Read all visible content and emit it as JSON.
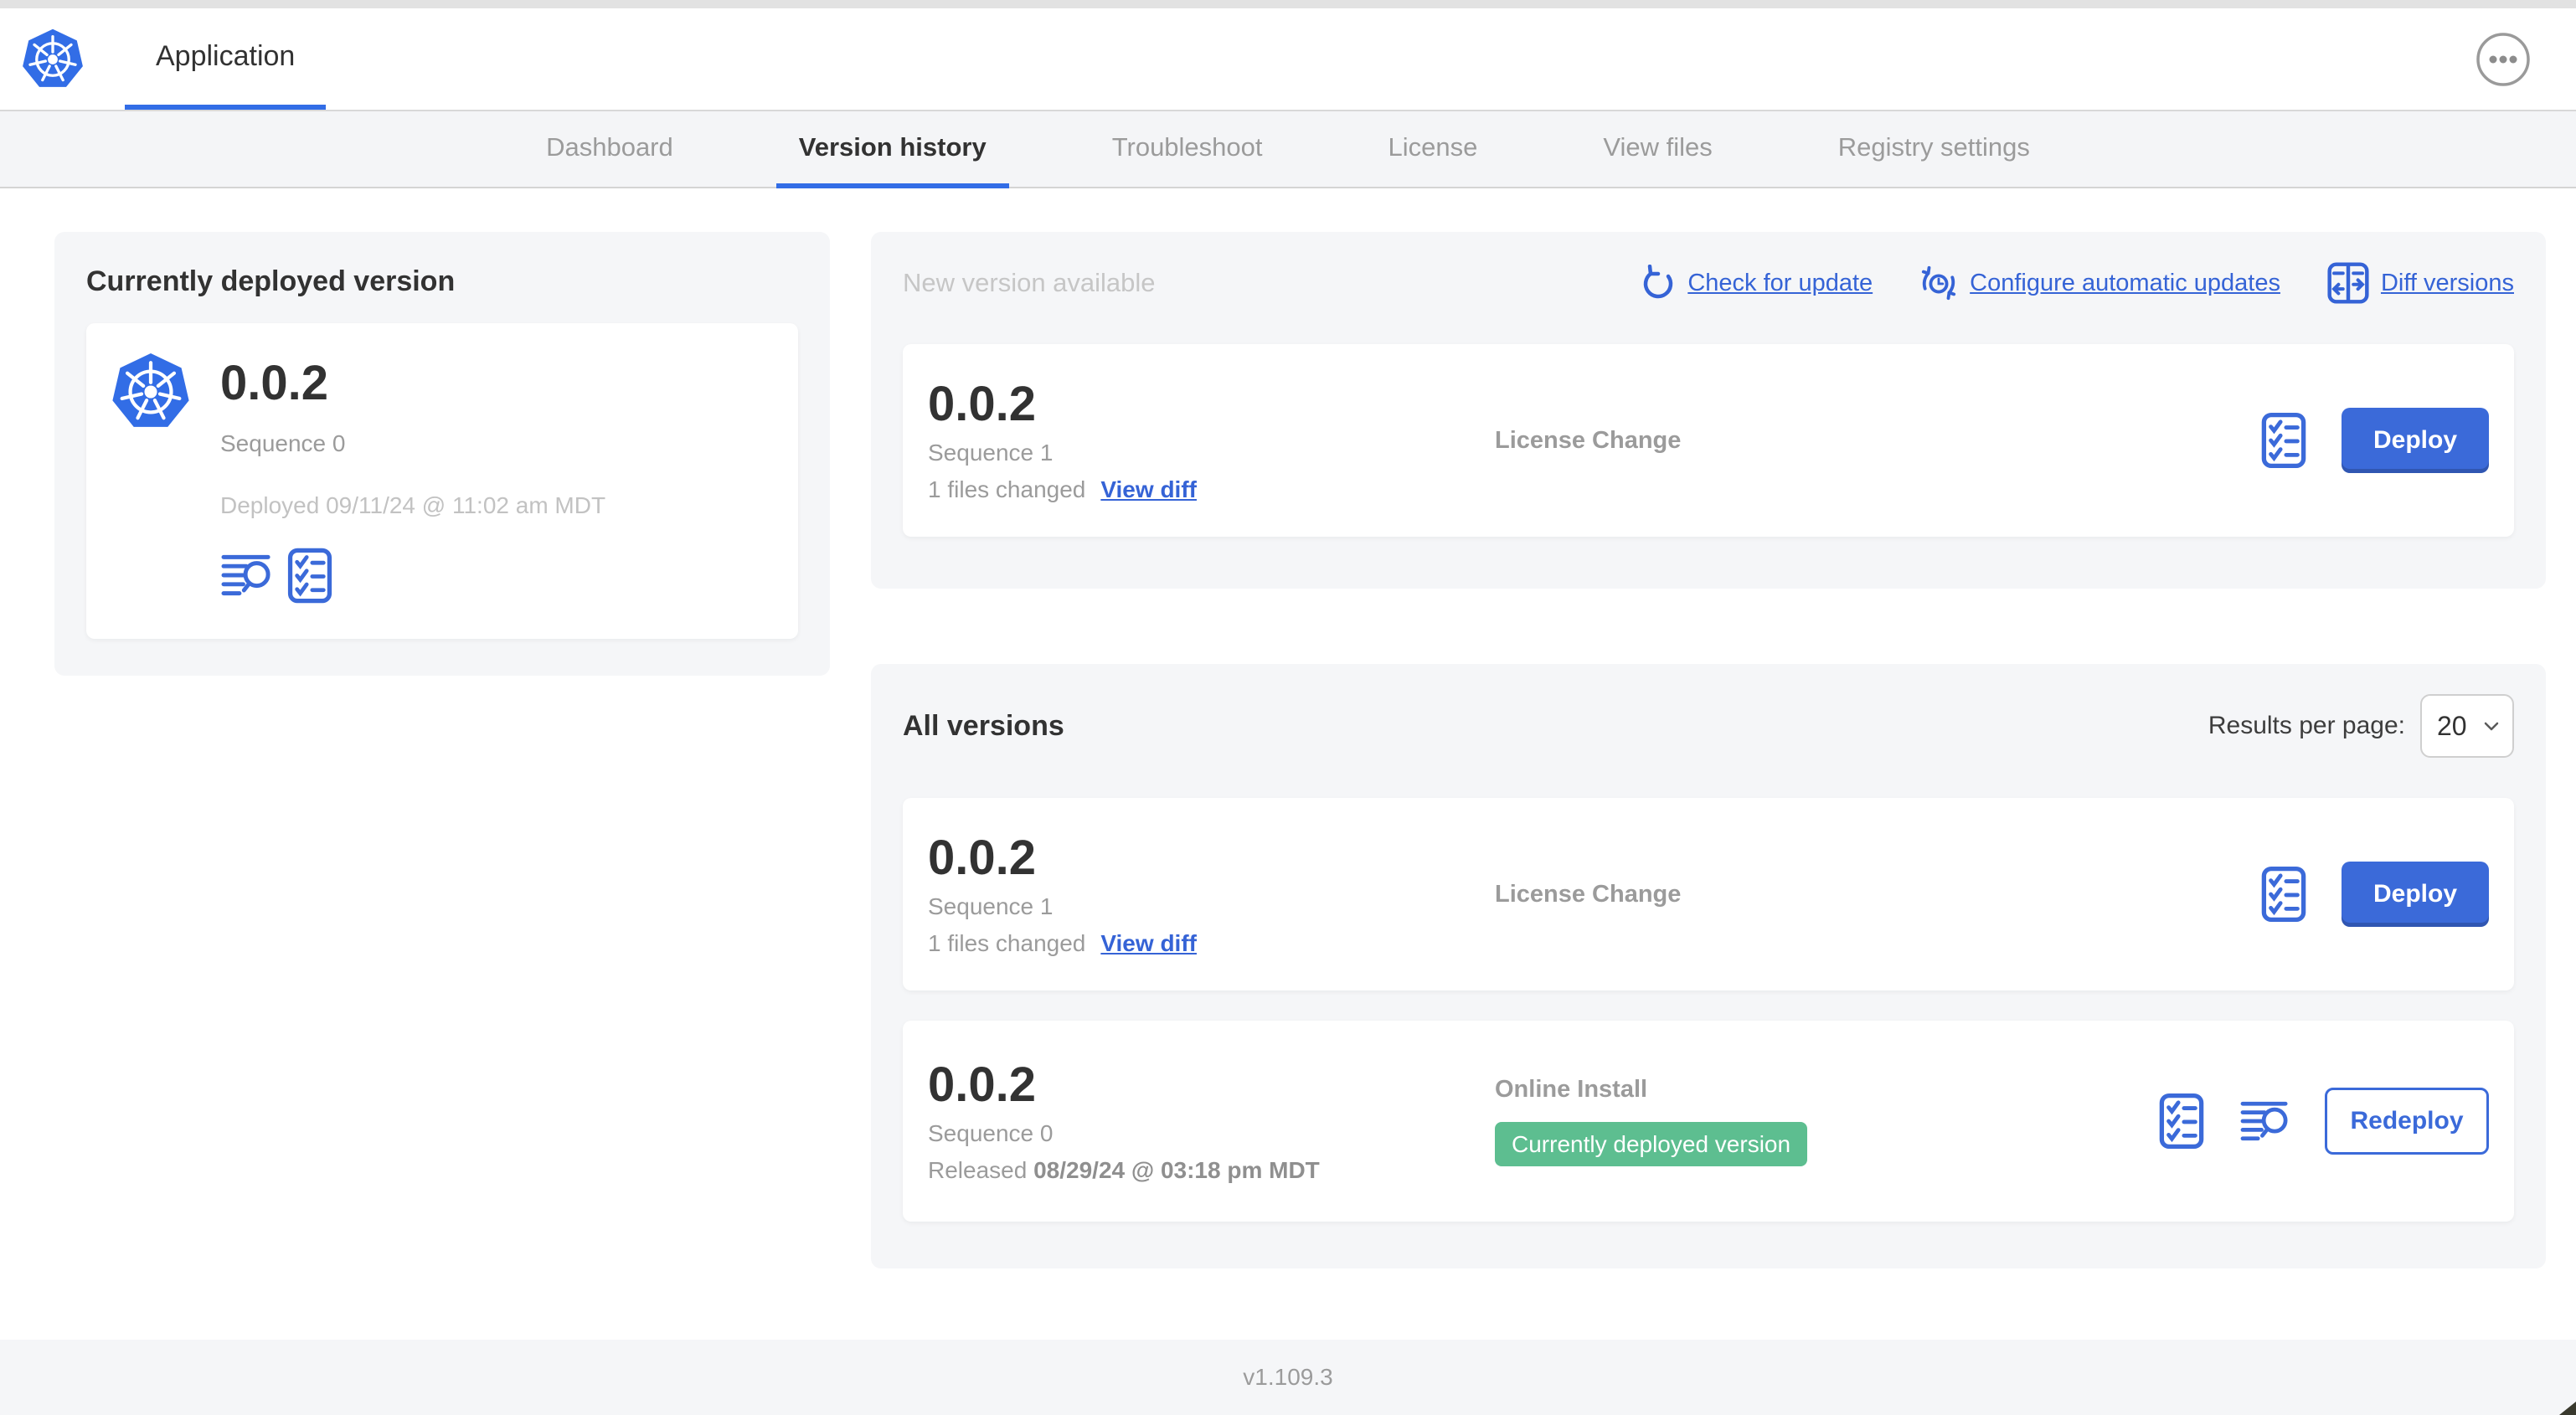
{
  "colors": {
    "primary_blue": "#326de6",
    "link_blue": "#3563d6",
    "badge_green": "#5dbe90",
    "panel_gray": "#f5f6f8",
    "text_dark": "#323232",
    "text_muted": "#9b9b9b",
    "text_faded": "#c6c6c6"
  },
  "header": {
    "app_tab_label": "Application",
    "menu_icon": "ellipsis-icon",
    "logo_icon": "kubernetes-logo-icon"
  },
  "nav": {
    "tabs": [
      {
        "label": "Dashboard",
        "active": false
      },
      {
        "label": "Version history",
        "active": true
      },
      {
        "label": "Troubleshoot",
        "active": false
      },
      {
        "label": "License",
        "active": false
      },
      {
        "label": "View files",
        "active": false
      },
      {
        "label": "Registry settings",
        "active": false
      }
    ]
  },
  "deployed_panel": {
    "title": "Currently deployed version",
    "version": "0.0.2",
    "sequence": "Sequence 0",
    "deployed_at": "Deployed 09/11/24 @ 11:02 am MDT",
    "icons": [
      "logs-icon",
      "preflight-checks-icon"
    ]
  },
  "new_version_panel": {
    "title": "New version available",
    "actions": [
      {
        "label": "Check for update",
        "icon": "refresh-icon"
      },
      {
        "label": "Configure automatic updates",
        "icon": "auto-update-clock-icon"
      },
      {
        "label": "Diff versions",
        "icon": "diff-icon"
      }
    ],
    "card": {
      "version": "0.0.2",
      "sequence": "Sequence 1",
      "files_changed": "1 files changed",
      "view_diff_label": "View diff",
      "source": "License Change",
      "deploy_label": "Deploy",
      "icons": [
        "preflight-checks-icon"
      ]
    }
  },
  "all_versions_panel": {
    "title": "All versions",
    "results_per_page_label": "Results per page:",
    "results_per_page_value": "20",
    "rows": [
      {
        "version": "0.0.2",
        "sequence": "Sequence 1",
        "files_changed": "1 files changed",
        "view_diff_label": "View diff",
        "source": "License Change",
        "action_label": "Deploy",
        "icons": [
          "preflight-checks-icon"
        ]
      },
      {
        "version": "0.0.2",
        "sequence": "Sequence 0",
        "released_prefix": "Released",
        "released_date": "08/29/24 @ 03:18 pm MDT",
        "source": "Online Install",
        "badge": "Currently deployed version",
        "action_label": "Redeploy",
        "icons": [
          "preflight-checks-icon",
          "logs-icon"
        ]
      }
    ]
  },
  "footer": {
    "app_version": "v1.109.3"
  }
}
